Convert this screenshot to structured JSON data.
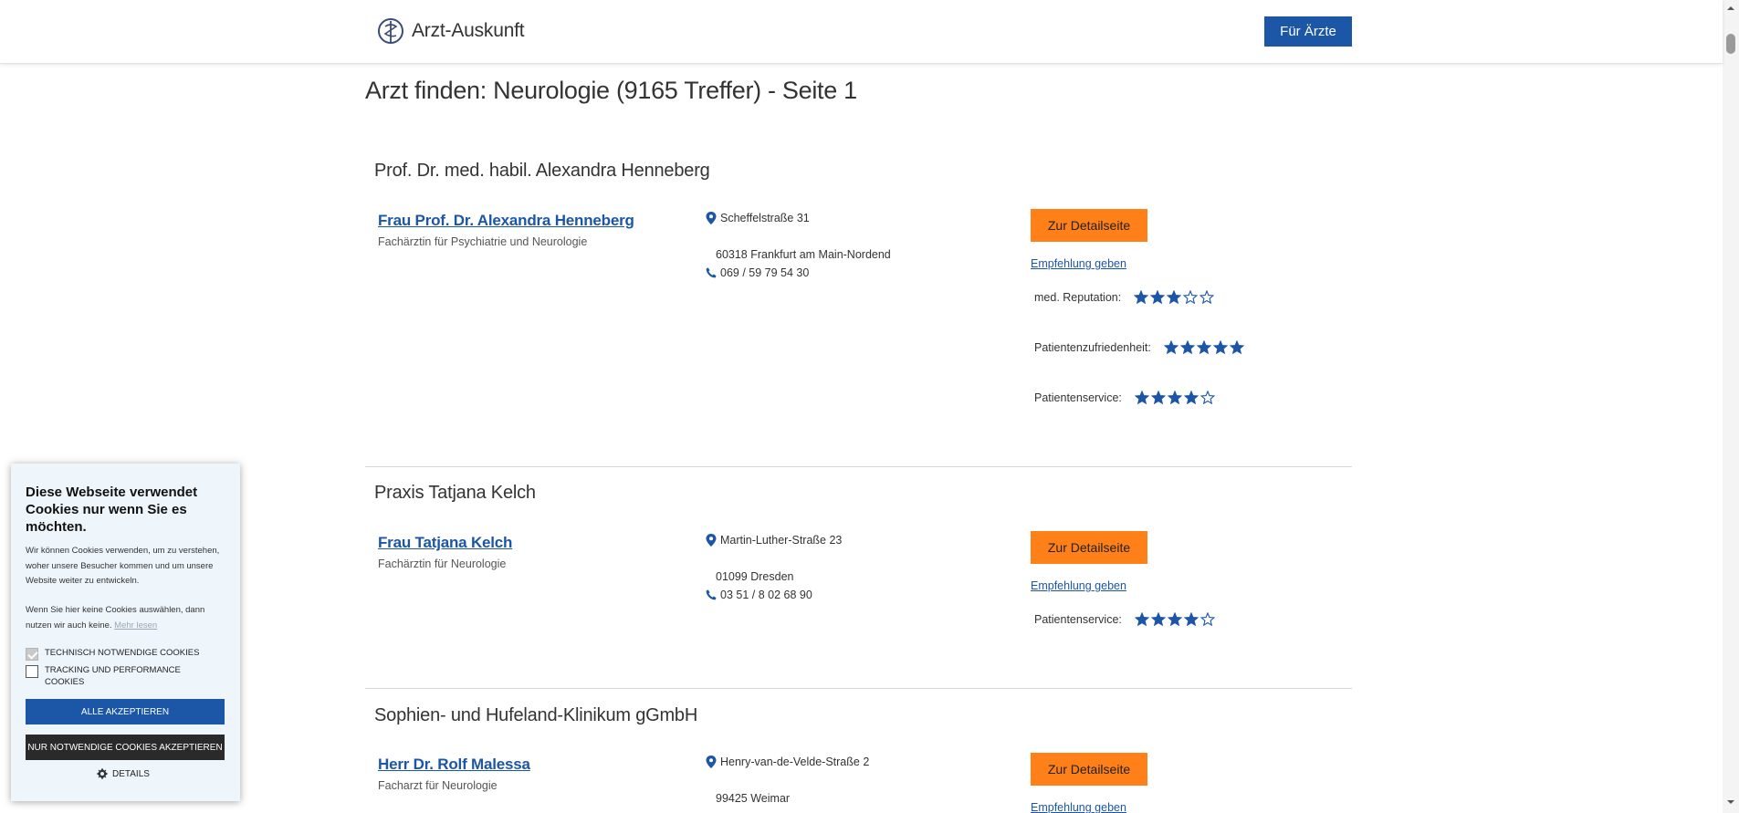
{
  "header": {
    "logo_text": "Arzt-Auskunft",
    "for_doctors_button": "Für Ärzte"
  },
  "page": {
    "title": "Arzt finden: Neurologie (9165 Treffer) - Seite 1"
  },
  "results": [
    {
      "practice": "Prof. Dr. med. habil. Alexandra Henneberg",
      "doctor": "Frau Prof. Dr. Alexandra Henneberg",
      "specialty": "Fachärztin für Psychiatrie und Neurologie",
      "street": "Scheffelstraße 31",
      "city": "60318 Frankfurt am Main-Nordend",
      "phone": "069 / 59 79 54 30",
      "detail_button": "Zur Detailseite",
      "recommend_link": "Empfehlung geben",
      "ratings": [
        {
          "label": "med. Reputation:",
          "stars": 3
        },
        {
          "label": "Patientenzufriedenheit:",
          "stars": 5
        },
        {
          "label": "Patientenservice:",
          "stars": 4
        }
      ]
    },
    {
      "practice": "Praxis Tatjana Kelch",
      "doctor": "Frau Tatjana Kelch",
      "specialty": "Fachärztin für Neurologie",
      "street": "Martin-Luther-Straße 23",
      "city": "01099 Dresden",
      "phone": "03 51 / 8 02 68 90",
      "detail_button": "Zur Detailseite",
      "recommend_link": "Empfehlung geben",
      "ratings": [
        {
          "label": "Patientenservice:",
          "stars": 4
        }
      ]
    },
    {
      "practice": "Sophien- und Hufeland-Klinikum gGmbH",
      "doctor": "Herr Dr. Rolf Malessa",
      "specialty": "Facharzt für Neurologie",
      "street": "Henry-van-de-Velde-Straße 2",
      "city": "99425 Weimar",
      "detail_button": "Zur Detailseite",
      "recommend_link": "Empfehlung geben"
    }
  ],
  "cookie_banner": {
    "title": "Diese Webseite verwendet Cookies nur wenn Sie es möchten.",
    "text1": "Wir können Cookies verwenden, um zu verstehen, woher unsere Besucher kommen und um unsere Website weiter zu entwickeln.",
    "text2": "Wenn Sie hier keine Cookies auswählen, dann nutzen wir auch keine.",
    "more_link": "Mehr lesen",
    "check_technical": "Technisch notwendige Cookies",
    "check_tracking": "Tracking und Performance Cookies",
    "accept_all": "Alle akzeptieren",
    "accept_necessary": "Nur notwendige Cookies akzeptieren",
    "details": "Details"
  },
  "colors": {
    "brand_blue": "#1c56a6",
    "button_orange": "#ff7f18",
    "cookie_bg": "#eef5fb"
  },
  "icons": [
    "logo-mark-icon",
    "location-pin-icon",
    "phone-icon",
    "star-filled-icon",
    "star-empty-icon",
    "gear-icon"
  ]
}
